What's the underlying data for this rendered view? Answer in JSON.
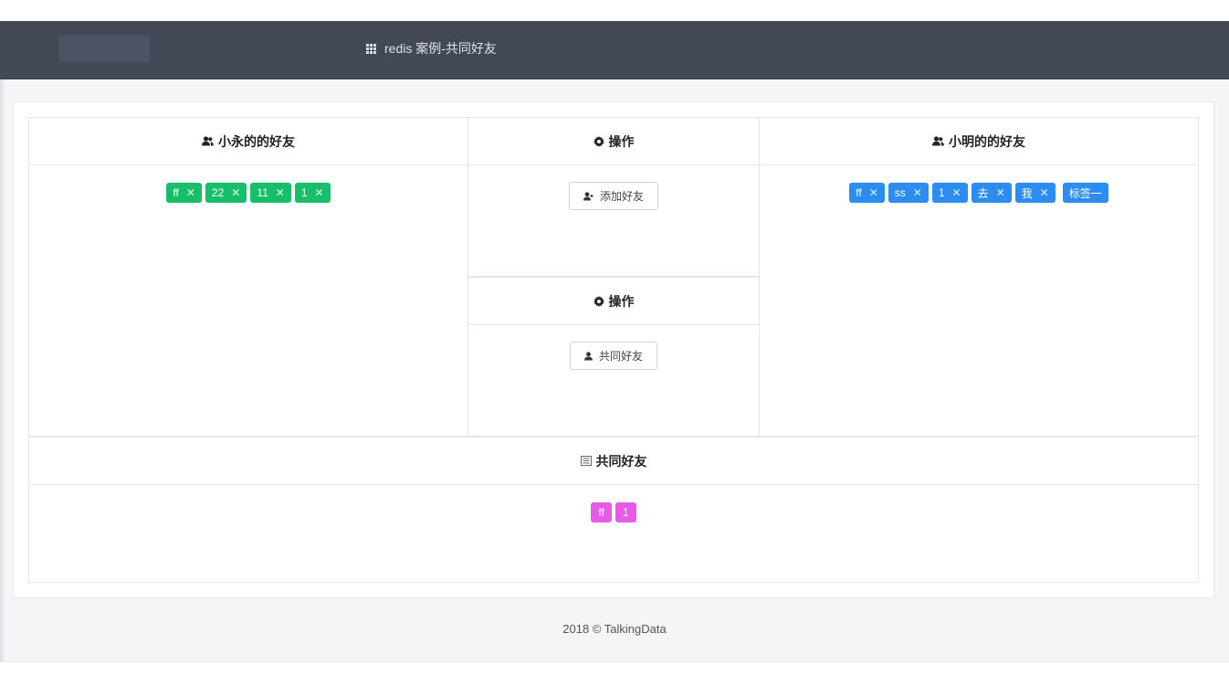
{
  "header": {
    "title": "redis 案例-共同好友",
    "title_icon": "grid-icon"
  },
  "panels": {
    "left": {
      "title": "小永的的好友",
      "icon": "users-icon",
      "tags": [
        "ff",
        "22",
        "11",
        "1"
      ],
      "tag_color": "#19be6b"
    },
    "op1": {
      "title": "操作",
      "icon": "gear-icon",
      "button_label": "添加好友",
      "button_icon": "user-add-icon"
    },
    "op2": {
      "title": "操作",
      "icon": "gear-icon",
      "button_label": "共同好友",
      "button_icon": "user-icon"
    },
    "right": {
      "title": "小明的的好友",
      "icon": "users-icon",
      "tags": [
        "ff",
        "ss",
        "1",
        "去",
        "我"
      ],
      "extra_tag": "标签一",
      "tag_color": "#2d8cf0"
    },
    "common": {
      "title": "共同好友",
      "icon": "list-icon",
      "tags": [
        "ff",
        "1"
      ],
      "tag_color": "#e65be8"
    }
  },
  "footer": {
    "text": "2018 © TalkingData"
  },
  "colors": {
    "header_bg": "#434857",
    "page_bg": "#f4f5f7"
  }
}
